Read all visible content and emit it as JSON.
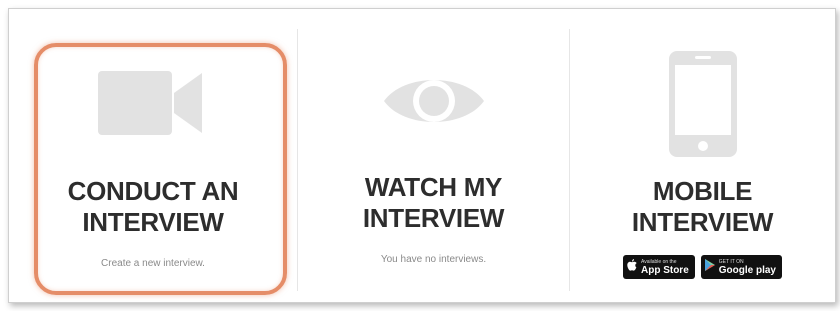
{
  "tiles": [
    {
      "icon": "video-camera-icon",
      "line1": "CONDUCT AN",
      "line2": "INTERVIEW",
      "subtitle": "Create a new interview."
    },
    {
      "icon": "eye-icon",
      "line1": "WATCH MY",
      "line2": "INTERVIEW",
      "subtitle": "You have no interviews."
    },
    {
      "icon": "smartphone-icon",
      "line1": "MOBILE",
      "line2": "INTERVIEW"
    }
  ],
  "badges": {
    "app_store": {
      "small": "Available on the",
      "big": "App Store"
    },
    "google_play": {
      "small": "GET IT ON",
      "big": "Google play"
    }
  },
  "colors": {
    "icon": "#e2e2e2",
    "title": "#2d2d2d",
    "highlight": "#e58d68"
  }
}
